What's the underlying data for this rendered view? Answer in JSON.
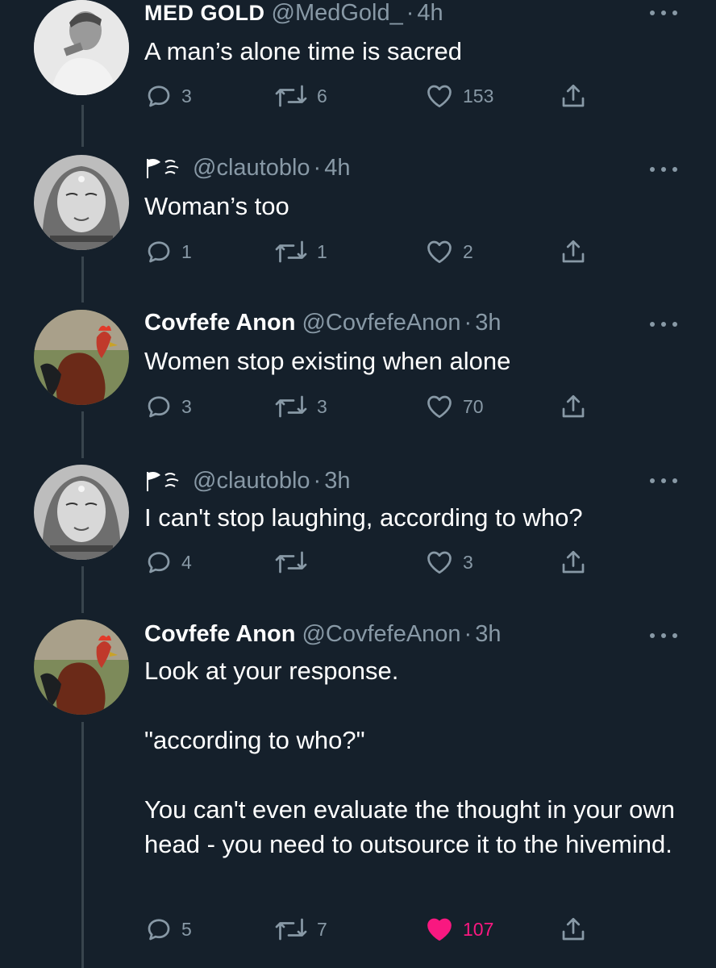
{
  "tweets": [
    {
      "name": "MED GOLD",
      "handle": "@MedGold_",
      "time": "4h",
      "text": "A man’s alone time is sacred",
      "replies": "3",
      "retweets": "6",
      "likes": "153",
      "liked": false
    },
    {
      "name": "",
      "handle": "@clautoblo",
      "time": "4h",
      "text": "Woman’s too",
      "replies": "1",
      "retweets": "1",
      "likes": "2",
      "liked": false
    },
    {
      "name": "Covfefe Anon",
      "handle": "@CovfefeAnon",
      "time": "3h",
      "text": "Women stop existing when alone",
      "replies": "3",
      "retweets": "3",
      "likes": "70",
      "liked": false
    },
    {
      "name": "",
      "handle": "@clautoblo",
      "time": "3h",
      "text": "I can't stop laughing, according to who?",
      "replies": "4",
      "retweets": "",
      "likes": "3",
      "liked": false
    },
    {
      "name": "Covfefe Anon",
      "handle": "@CovfefeAnon",
      "time": "3h",
      "text": "Look at your response.\n\n\"according to who?\"\n\nYou can't even evaluate the thought in your own head - you need to outsource it to the hivemind.",
      "replies": "5",
      "retweets": "7",
      "likes": "107",
      "liked": true
    }
  ],
  "separator": "·",
  "colors": {
    "background": "#15202b",
    "secondary_text": "#8899a6",
    "thread_line": "#38444d",
    "like_active": "#f91880"
  },
  "icons": {
    "reply": "reply-icon",
    "retweet": "retweet-icon",
    "like": "heart-icon",
    "share": "share-icon",
    "more": "more-icon"
  }
}
